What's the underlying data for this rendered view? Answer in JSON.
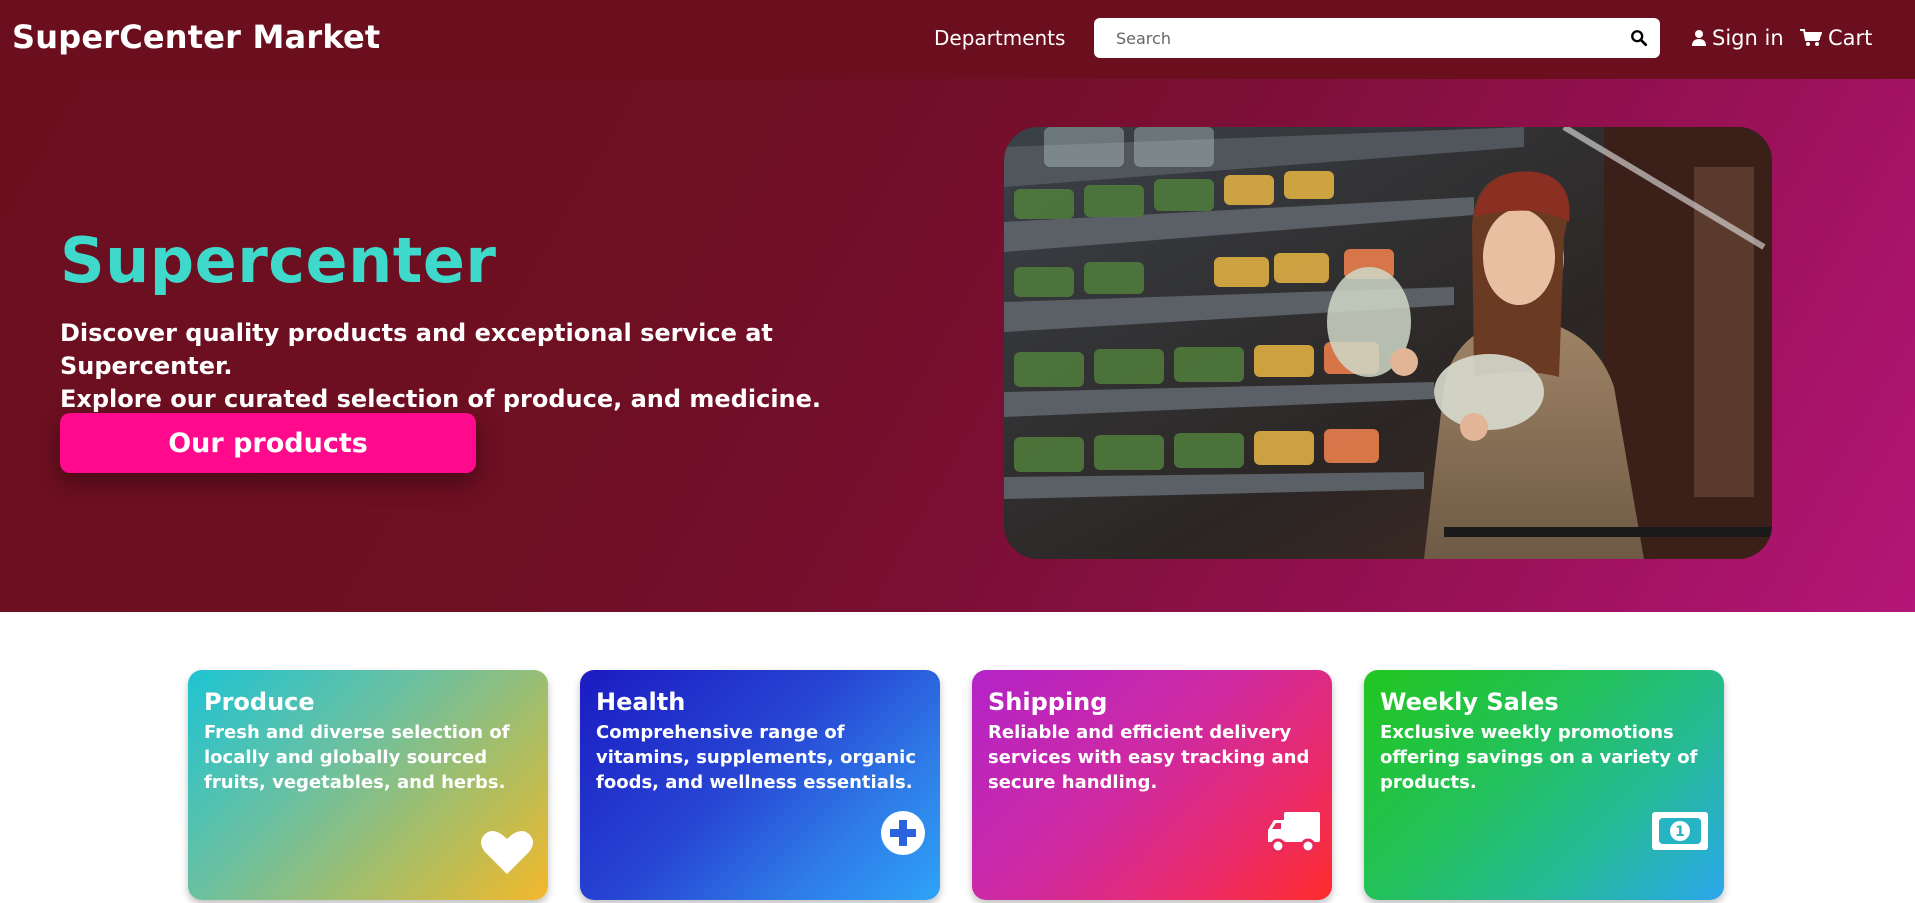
{
  "header": {
    "brand": "SuperCenter Market",
    "departments_label": "Departments",
    "search_placeholder": "Search",
    "signin_label": "Sign in",
    "cart_label": "Cart"
  },
  "hero": {
    "title": "Supercenter",
    "subtitle_line1": "Discover quality products and exceptional service at Supercenter.",
    "subtitle_line2": "Explore our curated selection of produce, and medicine.",
    "button_label": "Our products"
  },
  "cards": [
    {
      "title": "Produce",
      "description": "Fresh and diverse selection of locally and globally sourced fruits, vegetables, and herbs.",
      "icon": "heart-icon"
    },
    {
      "title": "Health",
      "description": "Comprehensive range of vitamins, supplements, organic foods, and wellness essentials.",
      "icon": "plus-circle-icon"
    },
    {
      "title": "Shipping",
      "description": "Reliable and efficient delivery services with easy tracking and secure handling.",
      "icon": "truck-icon"
    },
    {
      "title": "Weekly Sales",
      "description": "Exclusive weekly promotions offering savings on a variety of products.",
      "icon": "money-bill-icon"
    }
  ],
  "colors": {
    "header_bg": "#6b0f1f",
    "hero_title": "#3fd9cc",
    "cta_button": "#ff0a8c"
  }
}
